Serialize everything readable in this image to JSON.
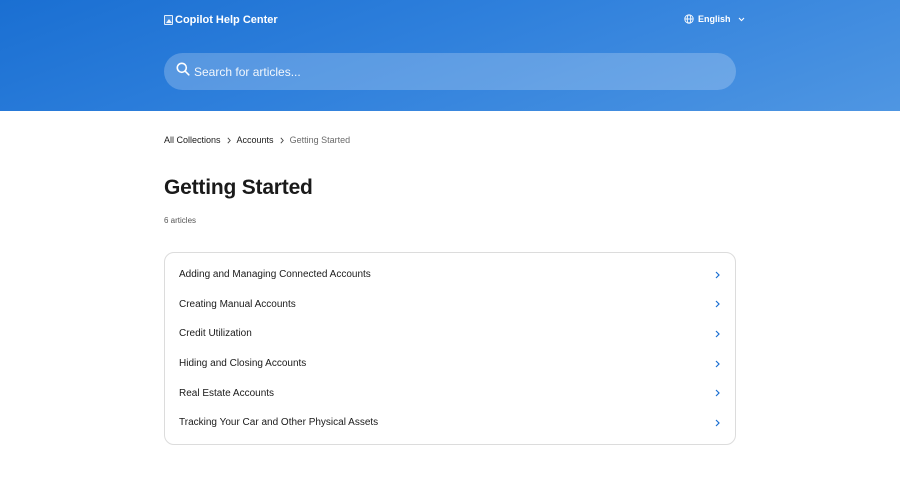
{
  "header": {
    "logo_text": "Copilot Help Center",
    "language": "English"
  },
  "search": {
    "placeholder": "Search for articles..."
  },
  "breadcrumb": {
    "items": [
      "All Collections",
      "Accounts"
    ],
    "current": "Getting Started"
  },
  "page": {
    "title": "Getting Started",
    "count": "6 articles"
  },
  "articles": [
    "Adding and Managing Connected Accounts",
    "Creating Manual Accounts",
    "Credit Utilization",
    "Hiding and Closing Accounts",
    "Real Estate Accounts",
    "Tracking Your Car and Other Physical Assets"
  ],
  "colors": {
    "hero_start": "#1a6fd2",
    "hero_end": "#4f96e2",
    "accent": "#1a6fd2"
  },
  "icons": {
    "logo": "broken-image-icon",
    "language": "globe-icon",
    "language_dropdown": "chevron-down-icon",
    "search": "search-icon",
    "breadcrumb_separator": "chevron-right-icon",
    "article_arrow": "chevron-right-icon"
  }
}
